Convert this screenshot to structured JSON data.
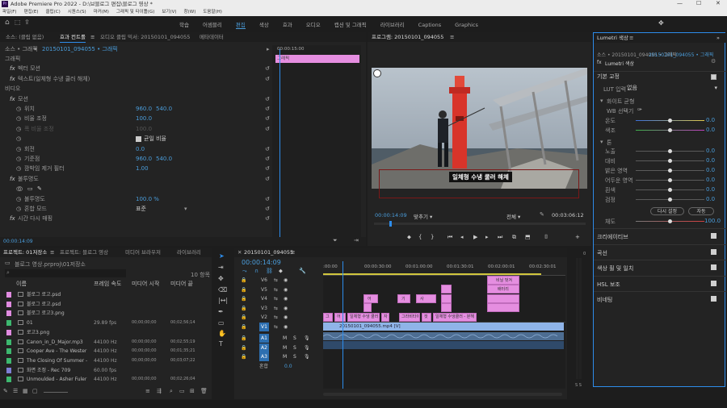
{
  "app": {
    "title": "Adobe Premiere Pro 2022 - D:\\브블로그 편집\\블로그 영상 *",
    "logo": "Pr"
  },
  "menu": [
    "파일(F)",
    "편집(E)",
    "클립(C)",
    "시퀀스(S)",
    "마커(M)",
    "그래픽 및 타이틀(G)",
    "보기(V)",
    "창(W)",
    "도움말(H)"
  ],
  "workspaces": [
    "학습",
    "어셈블리",
    "편집",
    "색상",
    "효과",
    "오디오",
    "캡션 및 그래픽",
    "라이브러리",
    "Captions",
    "Graphics"
  ],
  "active_workspace": "편집",
  "effect_controls": {
    "tabs": [
      "소스: (클립 없음)",
      "효과 컨트롤",
      "오디오 클립 믹서: 20150101_094055",
      "메타데이터"
    ],
    "source": "소스 • 그래픽",
    "clip": "20150101_094055 • 그래픽",
    "timecode": "00:00:15:00",
    "mini_clip": "그래픽",
    "rows": [
      {
        "label": "그래픽",
        "kind": "header"
      },
      {
        "label": "벡터 모션",
        "kind": "fx"
      },
      {
        "label": "텍스트(일체형 수냉 쿨러 해체)",
        "kind": "fx"
      },
      {
        "label": "비디오",
        "kind": "header"
      },
      {
        "label": "모션",
        "kind": "fx"
      },
      {
        "label": "위치",
        "v1": "960.0",
        "v2": "540.0"
      },
      {
        "label": "비율 조정",
        "v1": "100.0"
      },
      {
        "label": "폭 비율 조정",
        "v1": "100.0",
        "dim": true
      },
      {
        "label": "",
        "check": "균일 비율"
      },
      {
        "label": "회전",
        "v1": "0.0"
      },
      {
        "label": "기준점",
        "v1": "960.0",
        "v2": "540.0"
      },
      {
        "label": "깜박임 제거 필터",
        "v1": "1.00"
      },
      {
        "label": "불투명도",
        "kind": "fx"
      },
      {
        "label": "",
        "kind": "masks"
      },
      {
        "label": "불투명도",
        "v1": "100.0 %"
      },
      {
        "label": "혼합 모드",
        "v1": "표준",
        "kind": "select"
      },
      {
        "label": "시간 다시 매핑",
        "kind": "fx"
      }
    ],
    "footer_time": "00:00:14:09"
  },
  "program": {
    "title": "프로그램: 20150101_094055",
    "caption": "일체형 수냉 쿨러 해체",
    "timecode": "00:00:14:09",
    "fit": "맞추기",
    "quality": "전체",
    "duration": "00:03:06:12"
  },
  "lumetri": {
    "title": "Lumetri 색상",
    "source": "소스 • 20150101_094055 • 그래픽",
    "clip": "20150101_094055 • 그래픽",
    "section_label": "Lumetri 색상",
    "basic": "기본 교정",
    "lut_label": "LUT 입력",
    "lut_value": "없음",
    "wb": "화이트 균형",
    "wb_picker": "WB 선택기",
    "temp": {
      "label": "온도",
      "value": "0.0"
    },
    "tint": {
      "label": "색조",
      "value": "0.0"
    },
    "tone": "톤",
    "tones": [
      {
        "label": "노출",
        "value": "0.0"
      },
      {
        "label": "대비",
        "value": "0.0"
      },
      {
        "label": "밝은 영역",
        "value": "0.0"
      },
      {
        "label": "어두운 영역",
        "value": "0.0"
      },
      {
        "label": "흰색",
        "value": "0.0"
      },
      {
        "label": "검정",
        "value": "0.0"
      }
    ],
    "reset": "다시 설정",
    "auto": "자동",
    "sat": {
      "label": "채도",
      "value": "100.0"
    },
    "sections": [
      "크리에이티브",
      "곡선",
      "색상 휠 및 일치",
      "HSL 보조",
      "비네팅"
    ]
  },
  "project": {
    "tabs": [
      "프로젝트: 01저장소",
      "프로젝트: 블로그 영상",
      "미디어 브라우저",
      "라이브러리"
    ],
    "file": "블로그 영상.prproj\\01저장소",
    "count": "10 항목",
    "columns": [
      "이름",
      "프레임 속도",
      "미디어 시작",
      "미디어 끝"
    ],
    "items": [
      {
        "name": "블로그 로고.psd",
        "rate": "",
        "start": "",
        "end": "",
        "color": "#e08be0"
      },
      {
        "name": "블로그 로고.psd",
        "rate": "",
        "start": "",
        "end": "",
        "color": "#e08be0"
      },
      {
        "name": "블로그 로고3.png",
        "rate": "",
        "start": "",
        "end": "",
        "color": "#e08be0"
      },
      {
        "name": "01",
        "rate": "29.89 fps",
        "start": "00;00;00;00",
        "end": "00;02;56;14",
        "color": "#3db86f"
      },
      {
        "name": "로고3.png",
        "rate": "",
        "start": "",
        "end": "",
        "color": "#e08be0"
      },
      {
        "name": "Canon_in_D_Major.mp3",
        "rate": "44100 Hz",
        "start": "00;00;00;00",
        "end": "00;02;55;19",
        "color": "#3db86f"
      },
      {
        "name": "Cooper Ave - The Wester",
        "rate": "44100 Hz",
        "start": "00;00;00;00",
        "end": "00;01;35;21",
        "color": "#3db86f"
      },
      {
        "name": "The Closing Of Summer -",
        "rate": "44100 Hz",
        "start": "00;00;00;00",
        "end": "00;03;07;22",
        "color": "#3db86f"
      },
      {
        "name": "화면 조정 - Rec 709",
        "rate": "60.00 fps",
        "start": "",
        "end": "",
        "color": "#7f7fd6"
      },
      {
        "name": "Unmoulded - Asher Fuler",
        "rate": "44100 Hz",
        "start": "00;00;00;00",
        "end": "00;02;26;04",
        "color": "#3db86f"
      }
    ]
  },
  "timeline": {
    "name": "20150101_094055",
    "timecode": "00:00:14:09",
    "ruler": [
      ":00:00",
      "00:00:30:00",
      "00:01:00:00",
      "00:01:30:01",
      "00:02:00:01",
      "00:02:30:01"
    ],
    "video_tracks": [
      "V6",
      "V5",
      "V4",
      "V3",
      "V2",
      "V1"
    ],
    "audio_tracks": [
      "A1",
      "A2",
      "A3"
    ],
    "master": "혼합",
    "master_val": "0.0",
    "v1_clip": "20150101_094055.mp4 [V]",
    "v2_labels": [
      "그",
      "어",
      "일체형 수냉 쿨러 해",
      "자",
      "그라비타이",
      "컷",
      "일체형 수냉쿨러 - 분해"
    ],
    "v4_labels": [
      "어",
      "기",
      "사",
      "세",
      "그",
      "분해",
      "",
      ""
    ],
    "v5_labels": [
      "배터리"
    ],
    "v6_labels": [
      "비닐 벗겨"
    ]
  }
}
